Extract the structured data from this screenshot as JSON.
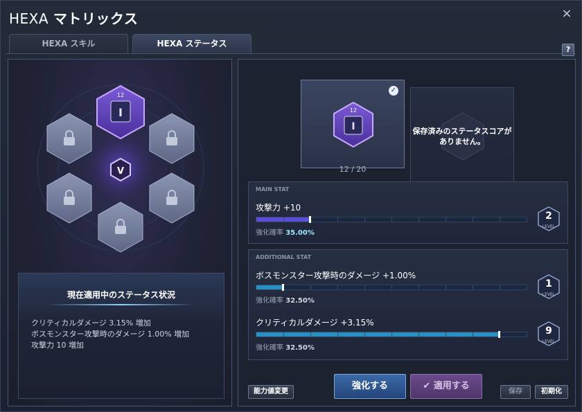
{
  "window": {
    "title_prefix": "HEXA",
    "title_main": "マトリックス",
    "close_glyph": "×",
    "help_glyph": "?"
  },
  "tabs": [
    {
      "label": "HEXA スキル",
      "active": false
    },
    {
      "label": "HEXA ステータス",
      "active": true
    }
  ],
  "hex_grid": {
    "core_level": "12",
    "core_icon": "I",
    "center_icon": "V",
    "locked_icon": "lock-icon"
  },
  "status_box": {
    "title": "現在適用中のステータス状況",
    "lines": [
      "クリティカルダメージ 3.15% 増加",
      "ボスモンスター攻撃時のダメージ 1.00% 増加",
      "攻撃力 10 増加"
    ]
  },
  "core_card": {
    "level": "12",
    "icon": "I",
    "counter": "12 / 20"
  },
  "saved_card": {
    "text": "保存済みのステータスコアが\nありません。"
  },
  "main_stat": {
    "section_label": "MAIN STAT",
    "name": "攻撃力 +10",
    "rate_label": "強化確率",
    "rate_value": "35.00%",
    "level": "2",
    "level_label": "LEVEL",
    "fill_fraction": 0.2,
    "color": "#5a4fd6"
  },
  "additional_stat": {
    "section_label": "ADDITIONAL STAT",
    "rows": [
      {
        "name": "ボスモンスター攻撃時のダメージ +1.00%",
        "rate_label": "強化確率",
        "rate_value": "32.50%",
        "level": "1",
        "level_label": "LEVEL",
        "fill_fraction": 0.1,
        "color": "#2a8fc2"
      },
      {
        "name": "クリティカルダメージ +3.15%",
        "rate_label": "強化確率",
        "rate_value": "32.50%",
        "level": "9",
        "level_label": "LEVEL",
        "fill_fraction": 0.9,
        "color": "#2a8fc2"
      }
    ]
  },
  "buttons": {
    "reset_stats": "能力値変更",
    "upgrade": "強化する",
    "apply": "適用する",
    "save": "保存",
    "initialize": "初期化"
  },
  "colors": {
    "rate_main": "#9fe6ff",
    "rate_additional": "#d0d6e0",
    "accent_purple": "#8a5cf6"
  }
}
